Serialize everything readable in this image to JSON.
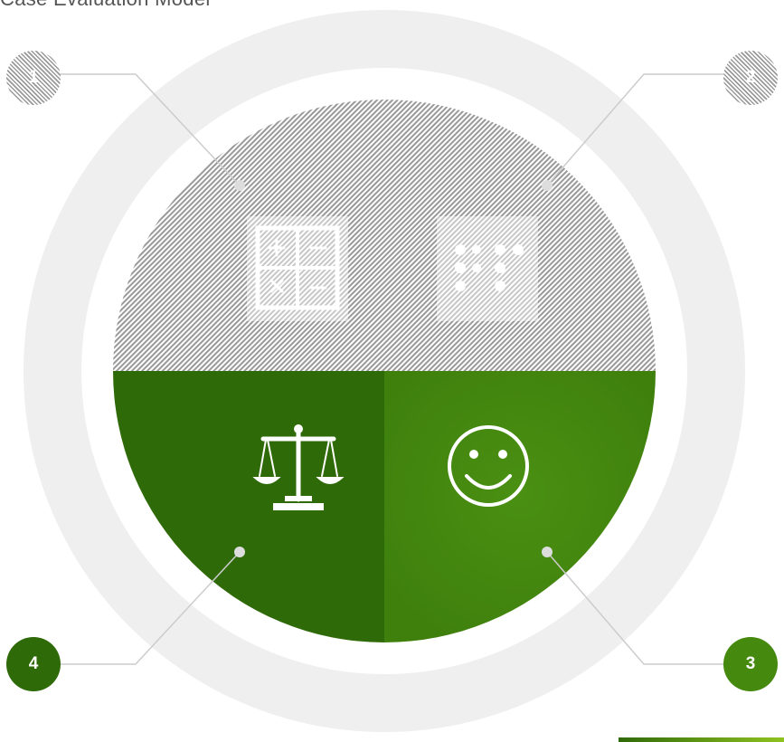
{
  "title": "Case Evaluation Model",
  "quadrants": [
    {
      "number": "1",
      "icon": "calculator-icon",
      "style": "hatched"
    },
    {
      "number": "2",
      "icon": "dot-grid-icon",
      "style": "hatched"
    },
    {
      "number": "3",
      "icon": "smiley-face-icon",
      "style": "green"
    },
    {
      "number": "4",
      "icon": "scales-of-justice-icon",
      "style": "dark-green"
    }
  ],
  "colors": {
    "ring": "#efefef",
    "dark_green": "#2f6a08",
    "light_green": "#45890f",
    "hatch": "#999999",
    "connector": "#cccccc"
  }
}
